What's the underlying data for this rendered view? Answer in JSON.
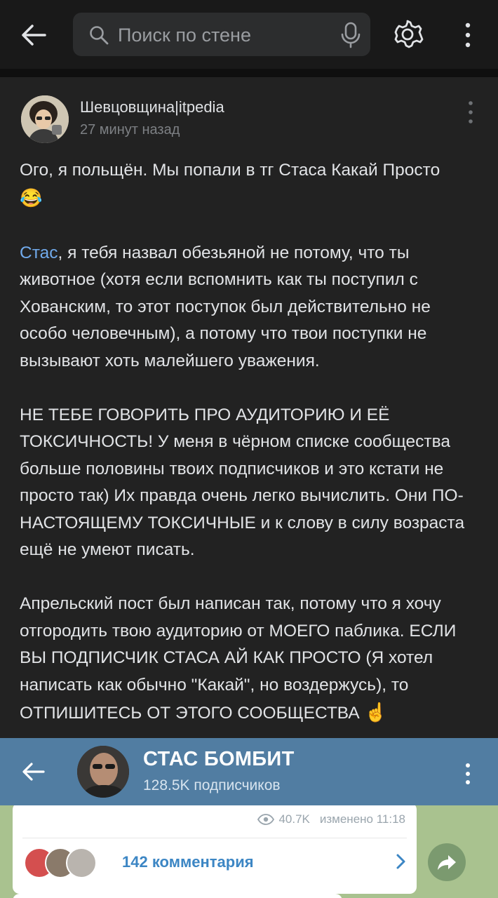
{
  "toolbar": {
    "search_placeholder": "Поиск по стене"
  },
  "post": {
    "author": "Шевцовщина|itpedia",
    "time": "27 минут назад",
    "line1": "Ого, я польщён. Мы попали в тг Стаса Какай Просто",
    "line1_emoji": "😂",
    "mention": "Стас",
    "para2": ", я тебя назвал обезьяной не потому, что ты животное (хотя если вспомнить как ты поступил с Хованским, то этот поступок был действительно не особо человечным), а потому что твои поступки не вызывают хоть малейшего уважения.",
    "para3": "НЕ ТЕБЕ ГОВОРИТЬ ПРО АУДИТОРИЮ И ЕЁ ТОКСИЧНОСТЬ! У меня в чёрном списке сообщества больше половины твоих подписчиков и это кстати не просто так) Их правда очень легко вычислить. Они ПО-НАСТОЯЩЕМУ ТОКСИЧНЫЕ и к слову в силу возраста ещё не умеют писать.",
    "para4": "Апрельский пост был написан так, потому что я хочу отгородить твою аудиторию от МОЕГО паблика. ЕСЛИ ВЫ ПОДПИСЧИК СТАСА АЙ КАК ПРОСТО (Я хотел написать как обычно \"Какай\", но воздержусь), то ОТПИШИТЕСЬ ОТ ЭТОГО СООБЩЕСТВА",
    "para4_emoji": "☝️"
  },
  "telegram": {
    "channel_title": "СТАС БОМБИТ",
    "subscribers": "128.5K подписчиков",
    "views": "40.7K",
    "edited": "изменено 11:18",
    "comments": "142 комментария"
  },
  "colors": {
    "background": "#191919",
    "post_bg": "#222222",
    "mention": "#71aaeb",
    "tg_header": "#517da2",
    "tg_chat_bg": "#a9c28f"
  }
}
